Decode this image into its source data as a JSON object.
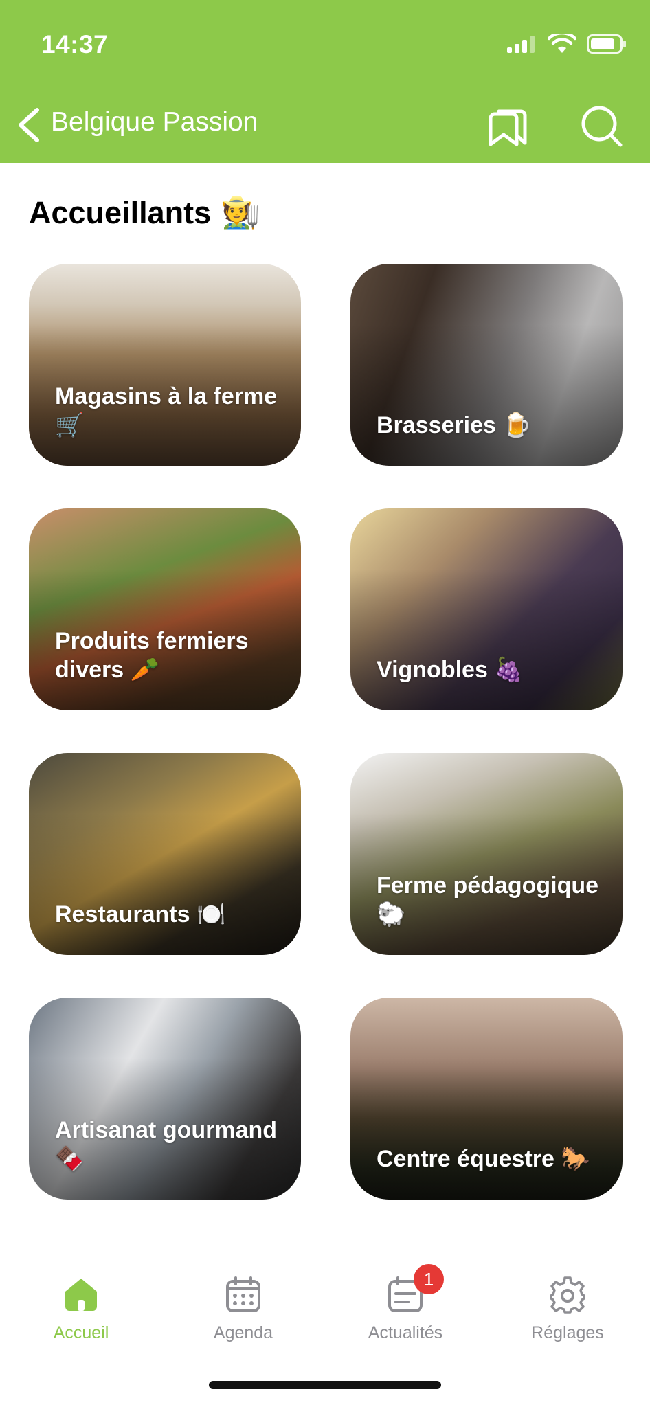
{
  "status_bar": {
    "time": "14:37"
  },
  "nav": {
    "title": "Belgique Passion"
  },
  "section": {
    "title": "Accueillants",
    "emoji": "🧑‍🌾"
  },
  "cards": [
    {
      "label": "Magasins à la ferme",
      "emoji": "🛒"
    },
    {
      "label": "Brasseries",
      "emoji": "🍺"
    },
    {
      "label": "Produits fermiers divers",
      "emoji": "🥕"
    },
    {
      "label": "Vignobles",
      "emoji": "🍇"
    },
    {
      "label": "Restaurants",
      "emoji": "🍽️"
    },
    {
      "label": "Ferme pédagogique",
      "emoji": "🐑"
    },
    {
      "label": "Artisanat gourmand",
      "emoji": "🍫"
    },
    {
      "label": "Centre équestre",
      "emoji": "🐎"
    }
  ],
  "tabs": [
    {
      "label": "Accueil",
      "icon": "home-icon",
      "active": true
    },
    {
      "label": "Agenda",
      "icon": "calendar-icon",
      "active": false
    },
    {
      "label": "Actualités",
      "icon": "news-icon",
      "active": false,
      "badge": "1"
    },
    {
      "label": "Réglages",
      "icon": "gear-icon",
      "active": false
    }
  ],
  "colors": {
    "brand": "#8dc94a",
    "badge": "#e53935",
    "inactive": "#8e8e93"
  }
}
